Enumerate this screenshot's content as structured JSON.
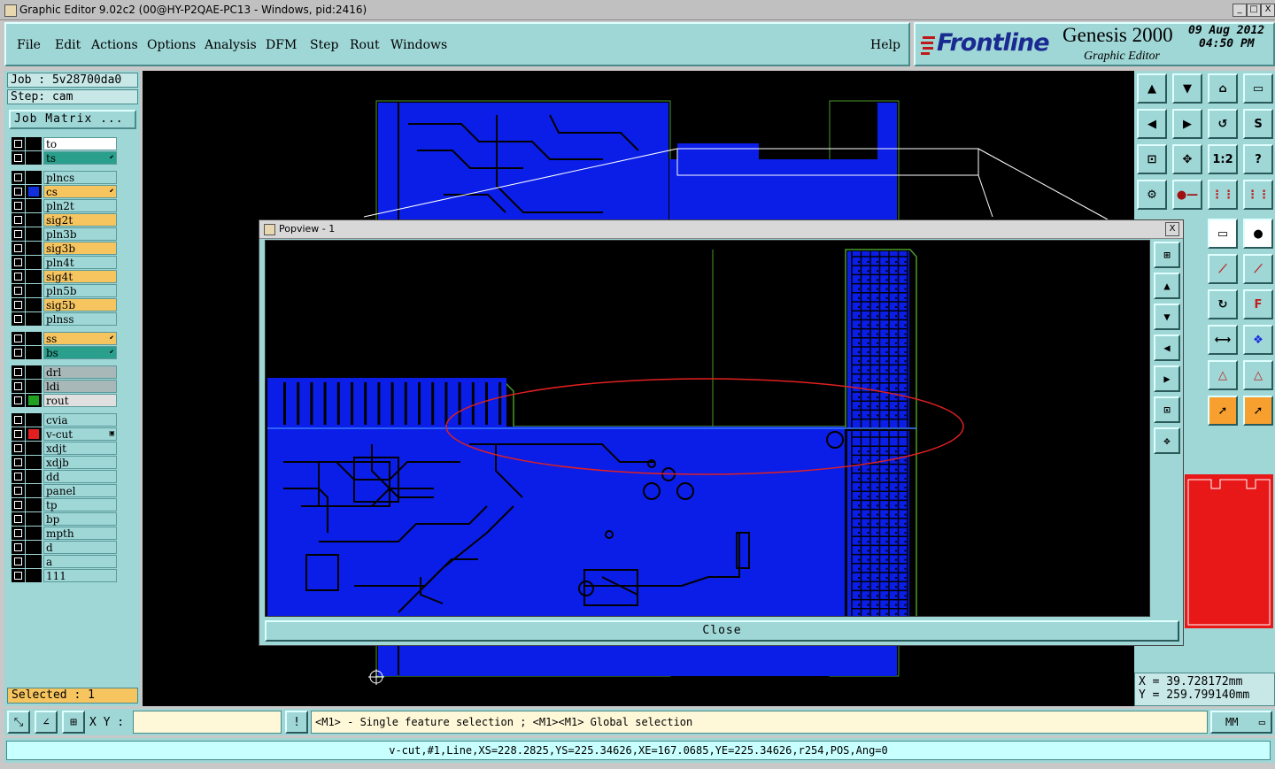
{
  "window": {
    "title": "Graphic Editor 9.02c2 (00@HY-P2QAE-PC13 - Windows, pid:2416)",
    "min_label": "_",
    "max_label": "□",
    "close_label": "X"
  },
  "menu": {
    "items": [
      "File",
      "Edit",
      "Actions",
      "Options",
      "Analysis",
      "DFM",
      "Step",
      "Rout",
      "Windows"
    ],
    "help": "Help"
  },
  "brand": {
    "logo": "Frontline",
    "product": "Genesis 2000",
    "subtitle": "Graphic Editor",
    "date": "09 Aug 2012",
    "time": "04:50 PM"
  },
  "job": {
    "job_label": "Job : 5v28700da0",
    "step_label": "Step: cam",
    "matrix_button": "Job Matrix ..."
  },
  "layers": [
    {
      "name": "to",
      "bg": "#ffffff",
      "swatch": "#000000",
      "marker": ""
    },
    {
      "name": "ts",
      "bg": "#2aa08c",
      "swatch": "#000000",
      "marker": "⬋"
    },
    {
      "name": "plncs",
      "bg": "#9fd6d6",
      "swatch": "#000000",
      "marker": ""
    },
    {
      "name": "cs",
      "bg": "#f7c560",
      "swatch": "#1030e0",
      "marker": "⬋"
    },
    {
      "name": "pln2t",
      "bg": "#9fd6d6",
      "swatch": "#000000",
      "marker": ""
    },
    {
      "name": "sig2t",
      "bg": "#f7c560",
      "swatch": "#000000",
      "marker": ""
    },
    {
      "name": "pln3b",
      "bg": "#9fd6d6",
      "swatch": "#000000",
      "marker": ""
    },
    {
      "name": "sig3b",
      "bg": "#f7c560",
      "swatch": "#000000",
      "marker": ""
    },
    {
      "name": "pln4t",
      "bg": "#9fd6d6",
      "swatch": "#000000",
      "marker": ""
    },
    {
      "name": "sig4t",
      "bg": "#f7c560",
      "swatch": "#000000",
      "marker": ""
    },
    {
      "name": "pln5b",
      "bg": "#9fd6d6",
      "swatch": "#000000",
      "marker": ""
    },
    {
      "name": "sig5b",
      "bg": "#f7c560",
      "swatch": "#000000",
      "marker": ""
    },
    {
      "name": "plnss",
      "bg": "#9fd6d6",
      "swatch": "#000000",
      "marker": ""
    },
    {
      "name": "ss",
      "bg": "#f7c560",
      "swatch": "#000000",
      "marker": "⬋"
    },
    {
      "name": "bs",
      "bg": "#2aa08c",
      "swatch": "#000000",
      "marker": "⬋"
    },
    {
      "name": "drl",
      "bg": "#a8b8b8",
      "swatch": "#000000",
      "marker": ""
    },
    {
      "name": "ldi",
      "bg": "#a8b8b8",
      "swatch": "#000000",
      "marker": ""
    },
    {
      "name": "rout",
      "bg": "#e0e0e0",
      "swatch": "#20a020",
      "marker": ""
    },
    {
      "name": "cvia",
      "bg": "#9fd6d6",
      "swatch": "#000000",
      "marker": ""
    },
    {
      "name": "v-cut",
      "bg": "#9fd6d6",
      "swatch": "#e02020",
      "marker": "▣"
    },
    {
      "name": "xdjt",
      "bg": "#9fd6d6",
      "swatch": "#000000",
      "marker": ""
    },
    {
      "name": "xdjb",
      "bg": "#9fd6d6",
      "swatch": "#000000",
      "marker": ""
    },
    {
      "name": "dd",
      "bg": "#9fd6d6",
      "swatch": "#000000",
      "marker": ""
    },
    {
      "name": "panel",
      "bg": "#9fd6d6",
      "swatch": "#000000",
      "marker": ""
    },
    {
      "name": "tp",
      "bg": "#9fd6d6",
      "swatch": "#000000",
      "marker": ""
    },
    {
      "name": "bp",
      "bg": "#9fd6d6",
      "swatch": "#000000",
      "marker": ""
    },
    {
      "name": "mpth",
      "bg": "#9fd6d6",
      "swatch": "#000000",
      "marker": ""
    },
    {
      "name": "d",
      "bg": "#9fd6d6",
      "swatch": "#000000",
      "marker": ""
    },
    {
      "name": "a",
      "bg": "#9fd6d6",
      "swatch": "#000000",
      "marker": ""
    },
    {
      "name": "111",
      "bg": "#9fd6d6",
      "swatch": "#000000",
      "marker": ""
    }
  ],
  "selected": "Selected : 1",
  "coords": {
    "x": "X  =  39.728172mm",
    "y": "Y  =  259.799140mm"
  },
  "popview": {
    "title": "Popview - 1",
    "close_x": "X",
    "close_button": "Close"
  },
  "toolbar_icons": [
    "export-icon",
    "import-icon",
    "home-icon",
    "window-icon",
    "pan-left-icon",
    "pan-right-icon",
    "undo-icon",
    "step-icon",
    "fit-icon",
    "zoom-center-icon",
    "scale-icon",
    "help-icon",
    "tools-icon",
    "probe-icon",
    "layers-icon",
    "layers-red-icon",
    "edit-icon",
    "ruler-icon",
    "pad-icon",
    "cut-icon",
    "connect-icon",
    "connect2-icon",
    "arc-icon",
    "rotate-icon",
    "text-icon",
    "line-icon",
    "measure-icon",
    "cluster-icon",
    "polygon-icon",
    "polygon2-icon",
    "polygon3-icon",
    "select-icon",
    "select2-icon",
    "select3-icon"
  ],
  "toolbar_labels": {
    "scale": "1:2",
    "help": "?"
  },
  "bottom": {
    "xy_label": "X Y :",
    "xy_value": "",
    "prompt_icon": "!",
    "prompt": "<M1> - Single feature selection ; <M1><M1> Global selection",
    "units": "MM",
    "status": "v-cut,#1,Line,XS=228.2825,YS=225.34626,XE=167.0685,YE=225.34626,r254,POS,Ang=0"
  },
  "colors": {
    "panel": "#9fd6d6",
    "copper": "#0a1ee8",
    "highlight": "#e02020",
    "outline": "#4a9a2a"
  }
}
